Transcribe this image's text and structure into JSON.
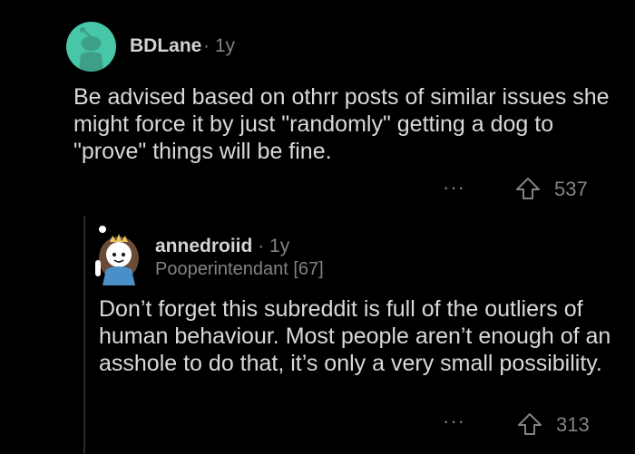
{
  "comments": [
    {
      "username": "BDLane",
      "separator": "·",
      "age": "1y",
      "body": "Be advised based on othrr posts of similar issues she might force it by just \"randomly\" getting a dog to \"prove\" things will be fine.",
      "more_label": "···",
      "score": "537",
      "avatar_color": "#47c6a8"
    },
    {
      "username": "annedroiid",
      "separator": "·",
      "age": "1y",
      "flair": "Pooperintendant [67]",
      "body": "Don’t forget this subreddit is full of the outliers of human behaviour. Most people aren’t enough of an asshole to do that, it’s only a very small possibility.",
      "more_label": "···",
      "score": "313"
    }
  ],
  "icons": {
    "avatar_1": "snoo-avatar-icon",
    "avatar_2": "custom-avatar-icon",
    "upvote": "upvote-arrow-icon",
    "more": "more-options-icon"
  },
  "colors": {
    "background": "#000000",
    "text": "#d7dadc",
    "muted": "#818384",
    "thread_line": "#2b2b2b"
  }
}
